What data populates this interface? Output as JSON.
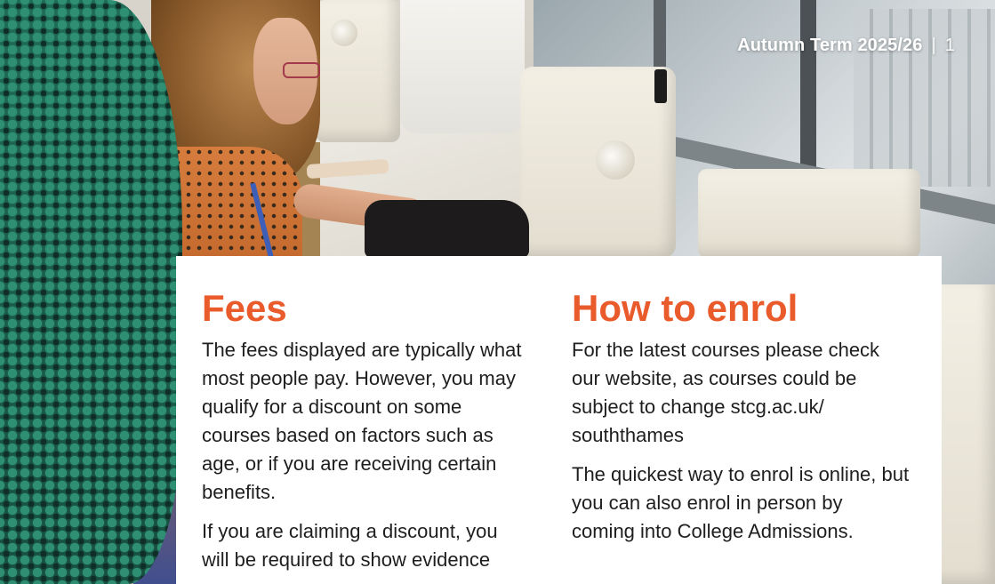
{
  "header": {
    "term": "Autumn Term 2025/26",
    "separator": "|",
    "page_number": "1"
  },
  "fees": {
    "heading": "Fees",
    "paragraphs": [
      "The fees displayed are typically what most people pay. However, you may qualify for a discount on some courses based on factors such as age, or if you are receiving certain benefits.",
      "If you are claiming a discount, you will be required to show evidence"
    ]
  },
  "enrol": {
    "heading": "How to enrol",
    "paragraphs": [
      "For the latest courses please check our website, as courses could be subject to change stcg.ac.uk/ souththames",
      "The quickest way to enrol is online, but you can also enrol in person by coming into College Admissions."
    ]
  },
  "colors": {
    "accent": "#ea5b2c",
    "body_text": "#1e1e1e",
    "panel": "#ffffff"
  }
}
